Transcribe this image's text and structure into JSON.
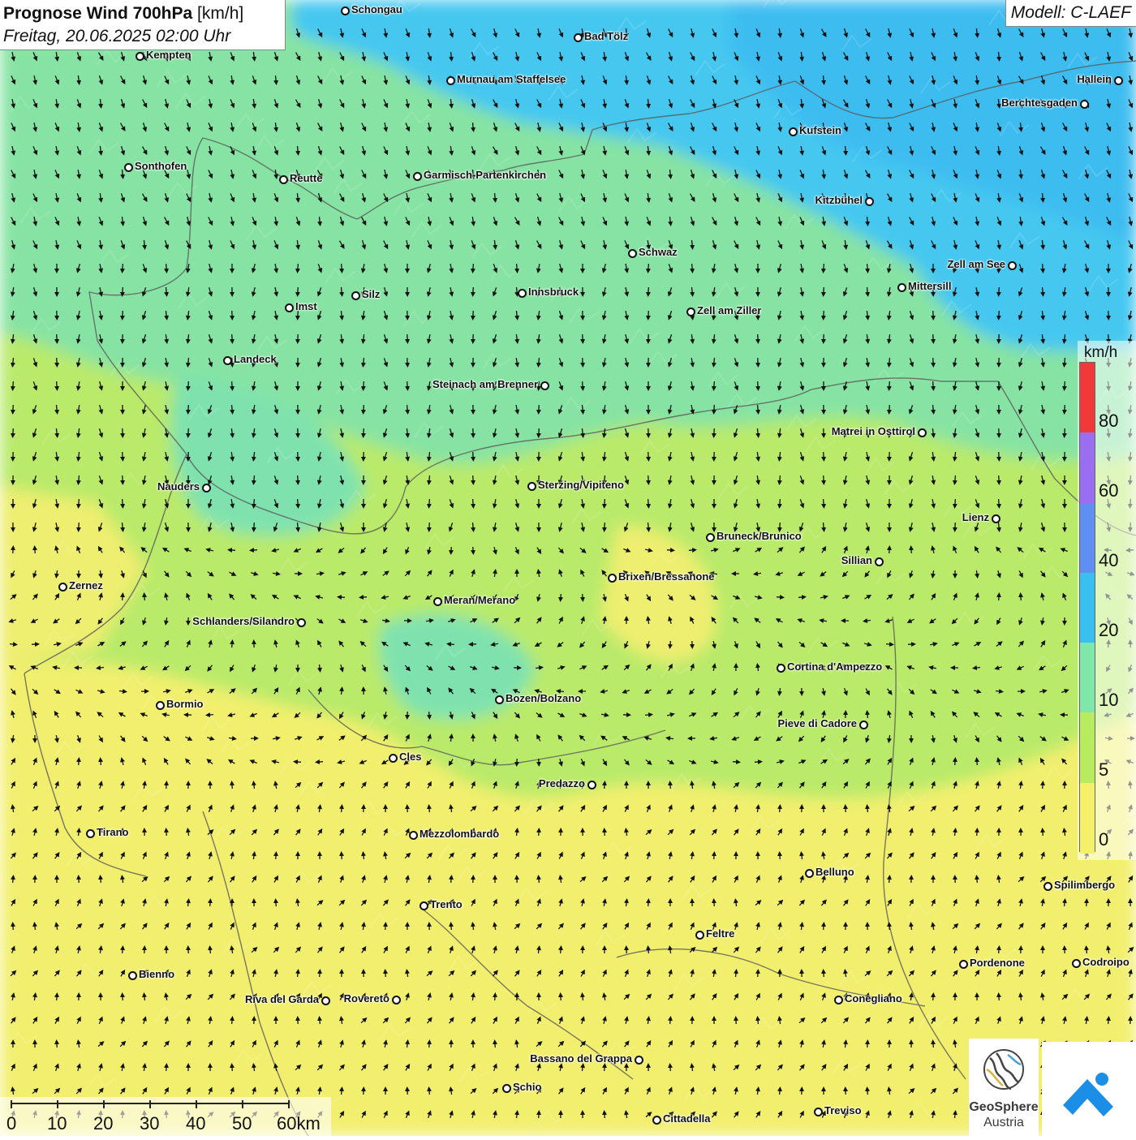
{
  "title": {
    "line1_bold": "Prognose Wind 700hPa",
    "line1_unit": "[km/h]",
    "line2": "Freitag, 20.06.2025 02:00 Uhr"
  },
  "model": "Modell: C-LAEF",
  "legend": {
    "unit": "km/h",
    "labels": [
      "80",
      "60",
      "40",
      "20",
      "10",
      "5",
      "0"
    ],
    "colors": [
      "#f03a3a",
      "#9a6ef0",
      "#5f8ff0",
      "#38c0f0",
      "#7fe8a8",
      "#b6ec5e",
      "#f5f06a"
    ]
  },
  "scale": {
    "labels": [
      "0",
      "10",
      "20",
      "30",
      "40",
      "50",
      "60km"
    ]
  },
  "logos": {
    "geosphere_line1": "GeoSphere",
    "geosphere_line2": "Austria"
  },
  "cities": [
    {
      "name": "Schongau"
    },
    {
      "name": "Bad Tölz"
    },
    {
      "name": "Kempten"
    },
    {
      "name": "Murnau am Staffelsee"
    },
    {
      "name": "Hallein"
    },
    {
      "name": "Berchtesgaden"
    },
    {
      "name": "Kufstein"
    },
    {
      "name": "Sonthofen"
    },
    {
      "name": "Reutte"
    },
    {
      "name": "Garmisch-Partenkirchen"
    },
    {
      "name": "Kitzbühel"
    },
    {
      "name": "Schwaz"
    },
    {
      "name": "Zell am See"
    },
    {
      "name": "Mittersill"
    },
    {
      "name": "Innsbruck"
    },
    {
      "name": "Silz"
    },
    {
      "name": "Imst"
    },
    {
      "name": "Zell am Ziller"
    },
    {
      "name": "Landeck"
    },
    {
      "name": "Steinach am Brenner"
    },
    {
      "name": "Matrei in Osttirol"
    },
    {
      "name": "Nauders"
    },
    {
      "name": "Sterzing/Vipiteno"
    },
    {
      "name": "Lienz"
    },
    {
      "name": "Bruneck/Brunico"
    },
    {
      "name": "Sillian"
    },
    {
      "name": "Brixen/Bressanone"
    },
    {
      "name": "Zernez"
    },
    {
      "name": "Meran/Merano"
    },
    {
      "name": "Schlanders/Silandro"
    },
    {
      "name": "Cortina d'Ampezzo"
    },
    {
      "name": "Bozen/Bolzano"
    },
    {
      "name": "Bormio"
    },
    {
      "name": "Pieve di Cadore"
    },
    {
      "name": "Cles"
    },
    {
      "name": "Predazzo"
    },
    {
      "name": "Tirano"
    },
    {
      "name": "Mezzolombardo"
    },
    {
      "name": "Belluno"
    },
    {
      "name": "Spilimbergo"
    },
    {
      "name": "Trento"
    },
    {
      "name": "Feltre"
    },
    {
      "name": "Pordenone"
    },
    {
      "name": "Codroipo"
    },
    {
      "name": "Bienno"
    },
    {
      "name": "Riva del Garda"
    },
    {
      "name": "Rovereto"
    },
    {
      "name": "Conegliano"
    },
    {
      "name": "Bassano del Grappa"
    },
    {
      "name": "Schio"
    },
    {
      "name": "Treviso"
    },
    {
      "name": "Cittadella"
    }
  ]
}
